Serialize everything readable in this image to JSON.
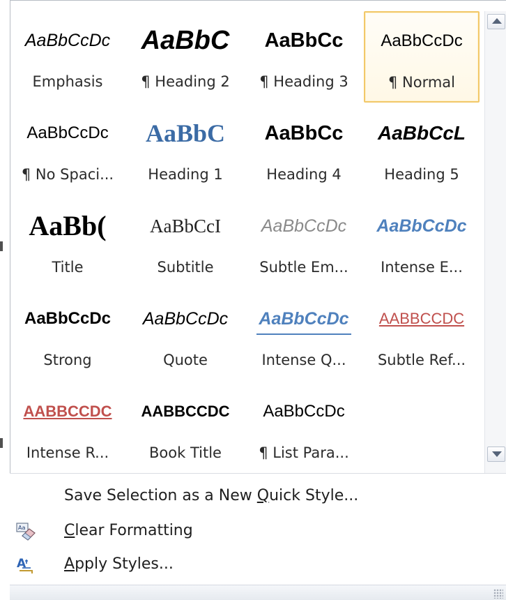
{
  "styles": [
    {
      "sample": "AaBbCcDc",
      "label": "Emphasis",
      "sample_css": "font-size:25px;font-style:italic;font-family:'Liberation Sans',sans-serif;"
    },
    {
      "sample": "AaBbC",
      "label": "¶ Heading 2",
      "sample_css": "font-size:38px;font-weight:bold;font-style:italic;font-family:'Liberation Sans',sans-serif;"
    },
    {
      "sample": "AaBbCc",
      "label": "¶ Heading 3",
      "sample_css": "font-size:29px;font-weight:bold;font-family:'Liberation Sans',sans-serif;"
    },
    {
      "sample": "AaBbCcDc",
      "label": "¶ Normal",
      "sample_css": "font-size:24px;font-family:'Liberation Sans',sans-serif;",
      "selected": true
    },
    {
      "sample": "AaBbCcDc",
      "label": "¶ No Spaci...",
      "sample_css": "font-size:24px;font-family:'Liberation Sans',sans-serif;"
    },
    {
      "sample": "AaBbC",
      "label": "Heading 1",
      "sample_css": "font-size:36px;font-weight:bold;font-family:'Liberation Serif',serif;color:#3b6ba5;"
    },
    {
      "sample": "AaBbCc",
      "label": "Heading 4",
      "sample_css": "font-size:29px;font-weight:bold;font-family:'Liberation Sans',sans-serif;"
    },
    {
      "sample": "AaBbCcL",
      "label": "Heading 5",
      "sample_css": "font-size:28px;font-weight:bold;font-style:italic;font-family:'Liberation Sans',sans-serif;"
    },
    {
      "sample": "AaBb(",
      "label": "Title",
      "sample_css": "font-size:40px;font-weight:bold;font-family:'Liberation Serif',serif;"
    },
    {
      "sample": "AaBbCcI",
      "label": "Subtitle",
      "sample_css": "font-size:27px;font-family:'Liberation Serif',serif;color:#222;"
    },
    {
      "sample": "AaBbCcDc",
      "label": "Subtle Em...",
      "sample_css": "font-size:25px;font-style:italic;font-family:'Liberation Sans',sans-serif;color:#8a8a8a;"
    },
    {
      "sample": "AaBbCcDc",
      "label": "Intense E...",
      "sample_css": "font-size:25px;font-style:italic;font-weight:bold;font-family:'Liberation Sans',sans-serif;color:#4f81bd;"
    },
    {
      "sample": "AaBbCcDc",
      "label": "Strong",
      "sample_css": "font-size:24px;font-weight:bold;font-family:'Liberation Sans',sans-serif;"
    },
    {
      "sample": "AaBbCcDc",
      "label": "Quote",
      "sample_css": "font-size:25px;font-style:italic;font-family:'Liberation Sans',sans-serif;"
    },
    {
      "sample": "AaBbCcDc",
      "label": "Intense Q...",
      "sample_css": "font-size:25px;font-style:italic;font-weight:bold;font-family:'Liberation Sans',sans-serif;color:#4f81bd;",
      "underline_bar": "#4f81bd"
    },
    {
      "sample": "AABBCCDC",
      "label": "Subtle Ref...",
      "sample_css": "font-size:22px;font-family:'Liberation Sans',sans-serif;color:#c0504d;text-decoration:underline;"
    },
    {
      "sample": "AABBCCDC",
      "label": "Intense R...",
      "sample_css": "font-size:22px;font-weight:bold;font-family:'Liberation Sans',sans-serif;color:#c0504d;text-decoration:underline;"
    },
    {
      "sample": "AABBCCDC",
      "label": "Book Title",
      "sample_css": "font-size:22px;font-weight:bold;font-family:'Liberation Sans',sans-serif;"
    },
    {
      "sample": "AaBbCcDc",
      "label": "¶ List Para...",
      "sample_css": "font-size:24px;font-family:'Liberation Sans',sans-serif;"
    }
  ],
  "menu": {
    "save_prefix": "Save Selection as a New ",
    "save_mnemonic": "Q",
    "save_suffix": "uick Style...",
    "clear_mnemonic": "C",
    "clear_suffix": "lear Formatting",
    "apply_mnemonic": "A",
    "apply_suffix": "pply Styles..."
  },
  "icons": {
    "scroll_up": "scroll-up-arrow-icon",
    "scroll_down": "scroll-down-arrow-icon",
    "clear": "clear-formatting-eraser-icon",
    "apply": "apply-styles-icon",
    "grip": "resize-grip-icon"
  },
  "colors": {
    "selected_border": "#f2c869",
    "accent_blue": "#4f81bd",
    "accent_red": "#c0504d"
  }
}
